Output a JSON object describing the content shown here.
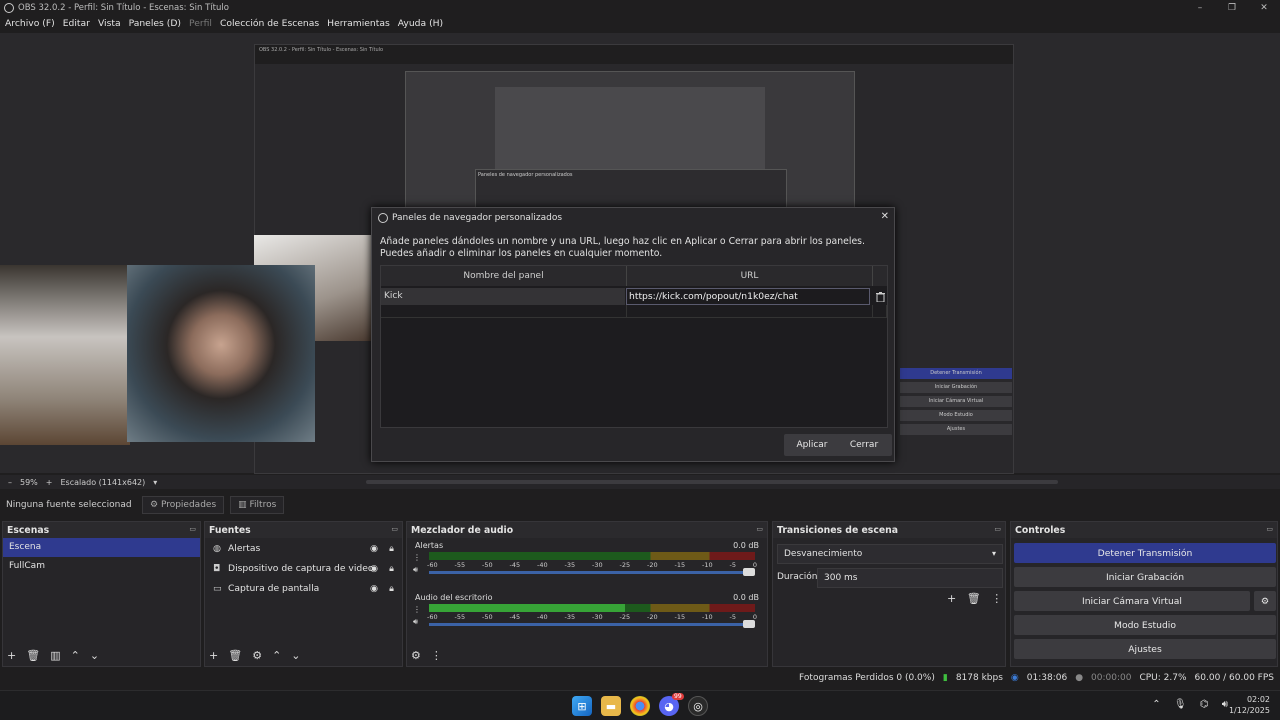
{
  "window": {
    "title": "OBS 32.0.2 - Perfil: Sin Título - Escenas: Sin Título",
    "min": "–",
    "max": "❐",
    "close": "✕"
  },
  "menu": [
    {
      "label": "Archivo (F)",
      "disabled": false
    },
    {
      "label": "Editar",
      "disabled": false
    },
    {
      "label": "Vista",
      "disabled": false
    },
    {
      "label": "Paneles (D)",
      "disabled": false
    },
    {
      "label": "Perfil",
      "disabled": true
    },
    {
      "label": "Colección de Escenas",
      "disabled": false
    },
    {
      "label": "Herramientas",
      "disabled": false
    },
    {
      "label": "Ayuda (H)",
      "disabled": false
    }
  ],
  "dialog": {
    "title": "Paneles de navegador personalizados",
    "description": "Añade paneles dándoles un nombre y una URL, luego haz clic en Aplicar o Cerrar para abrir los paneles. Puedes añadir o eliminar los paneles en cualquier momento.",
    "col_name": "Nombre del panel",
    "col_url": "URL",
    "row_name": "Kick",
    "row_url": "https://kick.com/popout/n1k0ez/chat",
    "apply": "Aplicar",
    "close": "Cerrar"
  },
  "zoom": {
    "minus": "–",
    "percent": "59%",
    "plus": "+",
    "scale": "Escalado (1141x642)"
  },
  "source_toolbar": {
    "none": "Ninguna fuente seleccionad",
    "properties": "Propiedades",
    "filters": "Filtros"
  },
  "scenes": {
    "title": "Escenas",
    "items": [
      "Escena",
      "FullCam"
    ],
    "selected": 0
  },
  "sources": {
    "title": "Fuentes",
    "items": [
      {
        "name": "Alertas",
        "icon": "globe-icon"
      },
      {
        "name": "Dispositivo de captura de video",
        "icon": "camera-icon"
      },
      {
        "name": "Captura de pantalla",
        "icon": "monitor-icon"
      }
    ]
  },
  "mixer": {
    "title": "Mezclador de audio",
    "channels": [
      {
        "name": "Alertas",
        "db": "0.0 dB",
        "level": 0.0
      },
      {
        "name": "Audio del escritorio",
        "db": "0.0 dB",
        "level": 0.6
      }
    ],
    "scale": [
      "-60",
      "-55",
      "-50",
      "-45",
      "-40",
      "-35",
      "-30",
      "-25",
      "-20",
      "-15",
      "-10",
      "-5",
      "0"
    ]
  },
  "transitions": {
    "title": "Transiciones de escena",
    "selected": "Desvanecimiento",
    "duration_label": "Duración",
    "duration": "300 ms"
  },
  "controls": {
    "title": "Controles",
    "buttons": [
      "Detener Transmisión",
      "Iniciar Grabación",
      "Iniciar Cámara Virtual",
      "Modo Estudio",
      "Ajustes"
    ]
  },
  "status": {
    "dropped": "Fotogramas Perdidos 0 (0.0%)",
    "bitrate": "8178 kbps",
    "stream_time": "01:38:06",
    "rec_time": "00:00:00",
    "cpu": "CPU: 2.7%",
    "fps": "60.00 / 60.00 FPS"
  },
  "clock": {
    "time": "02:02",
    "date": "1/12/2025"
  },
  "taskbar": {
    "badge": "99"
  }
}
